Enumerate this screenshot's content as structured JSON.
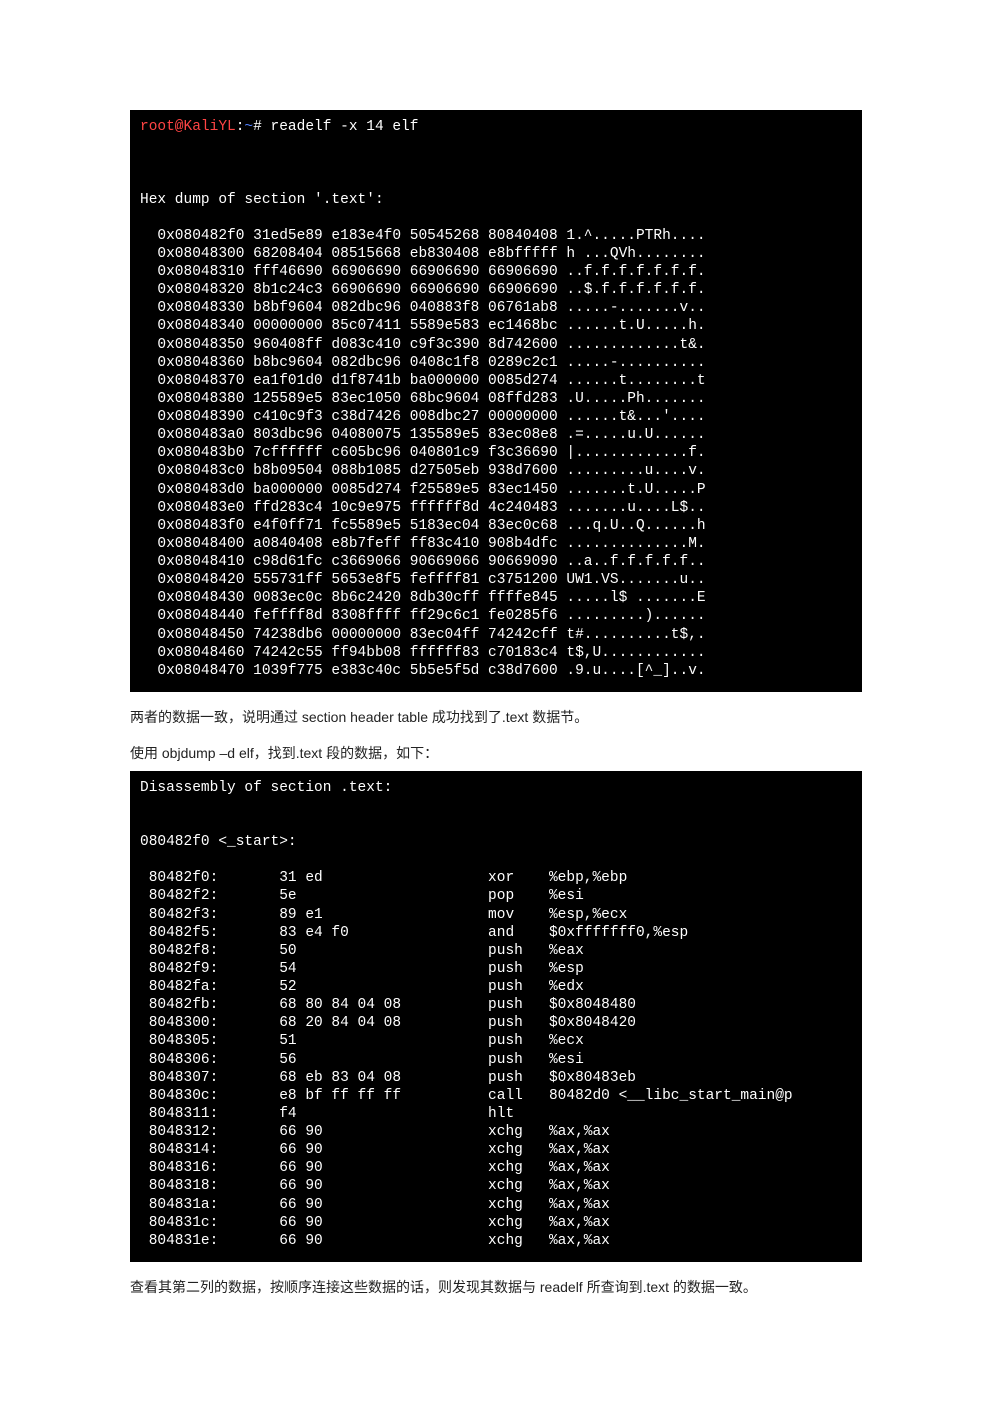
{
  "term1": {
    "prompt_user": "root@KaliYL",
    "prompt_sep": ":",
    "prompt_dir": "~",
    "prompt_end": "# ",
    "command": "readelf -x 14 elf",
    "header_line": "Hex dump of section '.text':",
    "rows": [
      "  0x080482f0 31ed5e89 e183e4f0 50545268 80840408 1.^.....PTRh....",
      "  0x08048300 68208404 08515668 eb830408 e8bfffff h ...QVh........",
      "  0x08048310 fff46690 66906690 66906690 66906690 ..f.f.f.f.f.f.f.",
      "  0x08048320 8b1c24c3 66906690 66906690 66906690 ..$.f.f.f.f.f.f.",
      "  0x08048330 b8bf9604 082dbc96 040883f8 06761ab8 .....-.......v..",
      "  0x08048340 00000000 85c07411 5589e583 ec1468bc ......t.U.....h.",
      "  0x08048350 960408ff d083c410 c9f3c390 8d742600 .............t&.",
      "  0x08048360 b8bc9604 082dbc96 0408c1f8 0289c2c1 .....-..........",
      "  0x08048370 ea1f01d0 d1f8741b ba000000 0085d274 ......t........t",
      "  0x08048380 125589e5 83ec1050 68bc9604 08ffd283 .U.....Ph.......",
      "  0x08048390 c410c9f3 c38d7426 008dbc27 00000000 ......t&...'....",
      "  0x080483a0 803dbc96 04080075 135589e5 83ec08e8 .=.....u.U......",
      "  0x080483b0 7cffffff c605bc96 040801c9 f3c36690 |.............f.",
      "  0x080483c0 b8b09504 088b1085 d27505eb 938d7600 .........u....v.",
      "  0x080483d0 ba000000 0085d274 f25589e5 83ec1450 .......t.U.....P",
      "  0x080483e0 ffd283c4 10c9e975 ffffff8d 4c240483 .......u....L$..",
      "  0x080483f0 e4f0ff71 fc5589e5 5183ec04 83ec0c68 ...q.U..Q......h",
      "  0x08048400 a0840408 e8b7feff ff83c410 908b4dfc ..............M.",
      "  0x08048410 c98d61fc c3669066 90669066 90669090 ..a..f.f.f.f.f..",
      "  0x08048420 555731ff 5653e8f5 feffff81 c3751200 UW1.VS.......u..",
      "  0x08048430 0083ec0c 8b6c2420 8db30cff ffffe845 .....l$ .......E",
      "  0x08048440 feffff8d 8308ffff ff29c6c1 fe0285f6 .........)......",
      "  0x08048450 74238db6 00000000 83ec04ff 74242cff t#..........t$,.",
      "  0x08048460 74242c55 ff94bb08 ffffff83 c70183c4 t$,U............",
      "  0x08048470 1039f775 e383c40c 5b5e5f5d c38d7600 .9.u....[^_]..v."
    ]
  },
  "para1": "两者的数据一致，说明通过 section header table 成功找到了.text 数据节。",
  "para2": "使用 objdump –d elf，找到.text 段的数据，如下：",
  "term2": {
    "header": "Disassembly of section .text:",
    "blank": "",
    "label": "080482f0 <_start>:",
    "rows": [
      " 80482f0:       31 ed                   xor    %ebp,%ebp",
      " 80482f2:       5e                      pop    %esi",
      " 80482f3:       89 e1                   mov    %esp,%ecx",
      " 80482f5:       83 e4 f0                and    $0xfffffff0,%esp",
      " 80482f8:       50                      push   %eax",
      " 80482f9:       54                      push   %esp",
      " 80482fa:       52                      push   %edx",
      " 80482fb:       68 80 84 04 08          push   $0x8048480",
      " 8048300:       68 20 84 04 08          push   $0x8048420",
      " 8048305:       51                      push   %ecx",
      " 8048306:       56                      push   %esi",
      " 8048307:       68 eb 83 04 08          push   $0x80483eb",
      " 804830c:       e8 bf ff ff ff          call   80482d0 <__libc_start_main@p",
      " 8048311:       f4                      hlt",
      " 8048312:       66 90                   xchg   %ax,%ax",
      " 8048314:       66 90                   xchg   %ax,%ax",
      " 8048316:       66 90                   xchg   %ax,%ax",
      " 8048318:       66 90                   xchg   %ax,%ax",
      " 804831a:       66 90                   xchg   %ax,%ax",
      " 804831c:       66 90                   xchg   %ax,%ax",
      " 804831e:       66 90                   xchg   %ax,%ax"
    ]
  },
  "para3": "查看其第二列的数据，按顺序连接这些数据的话，则发现其数据与 readelf 所查询到.text 的数据一致。"
}
